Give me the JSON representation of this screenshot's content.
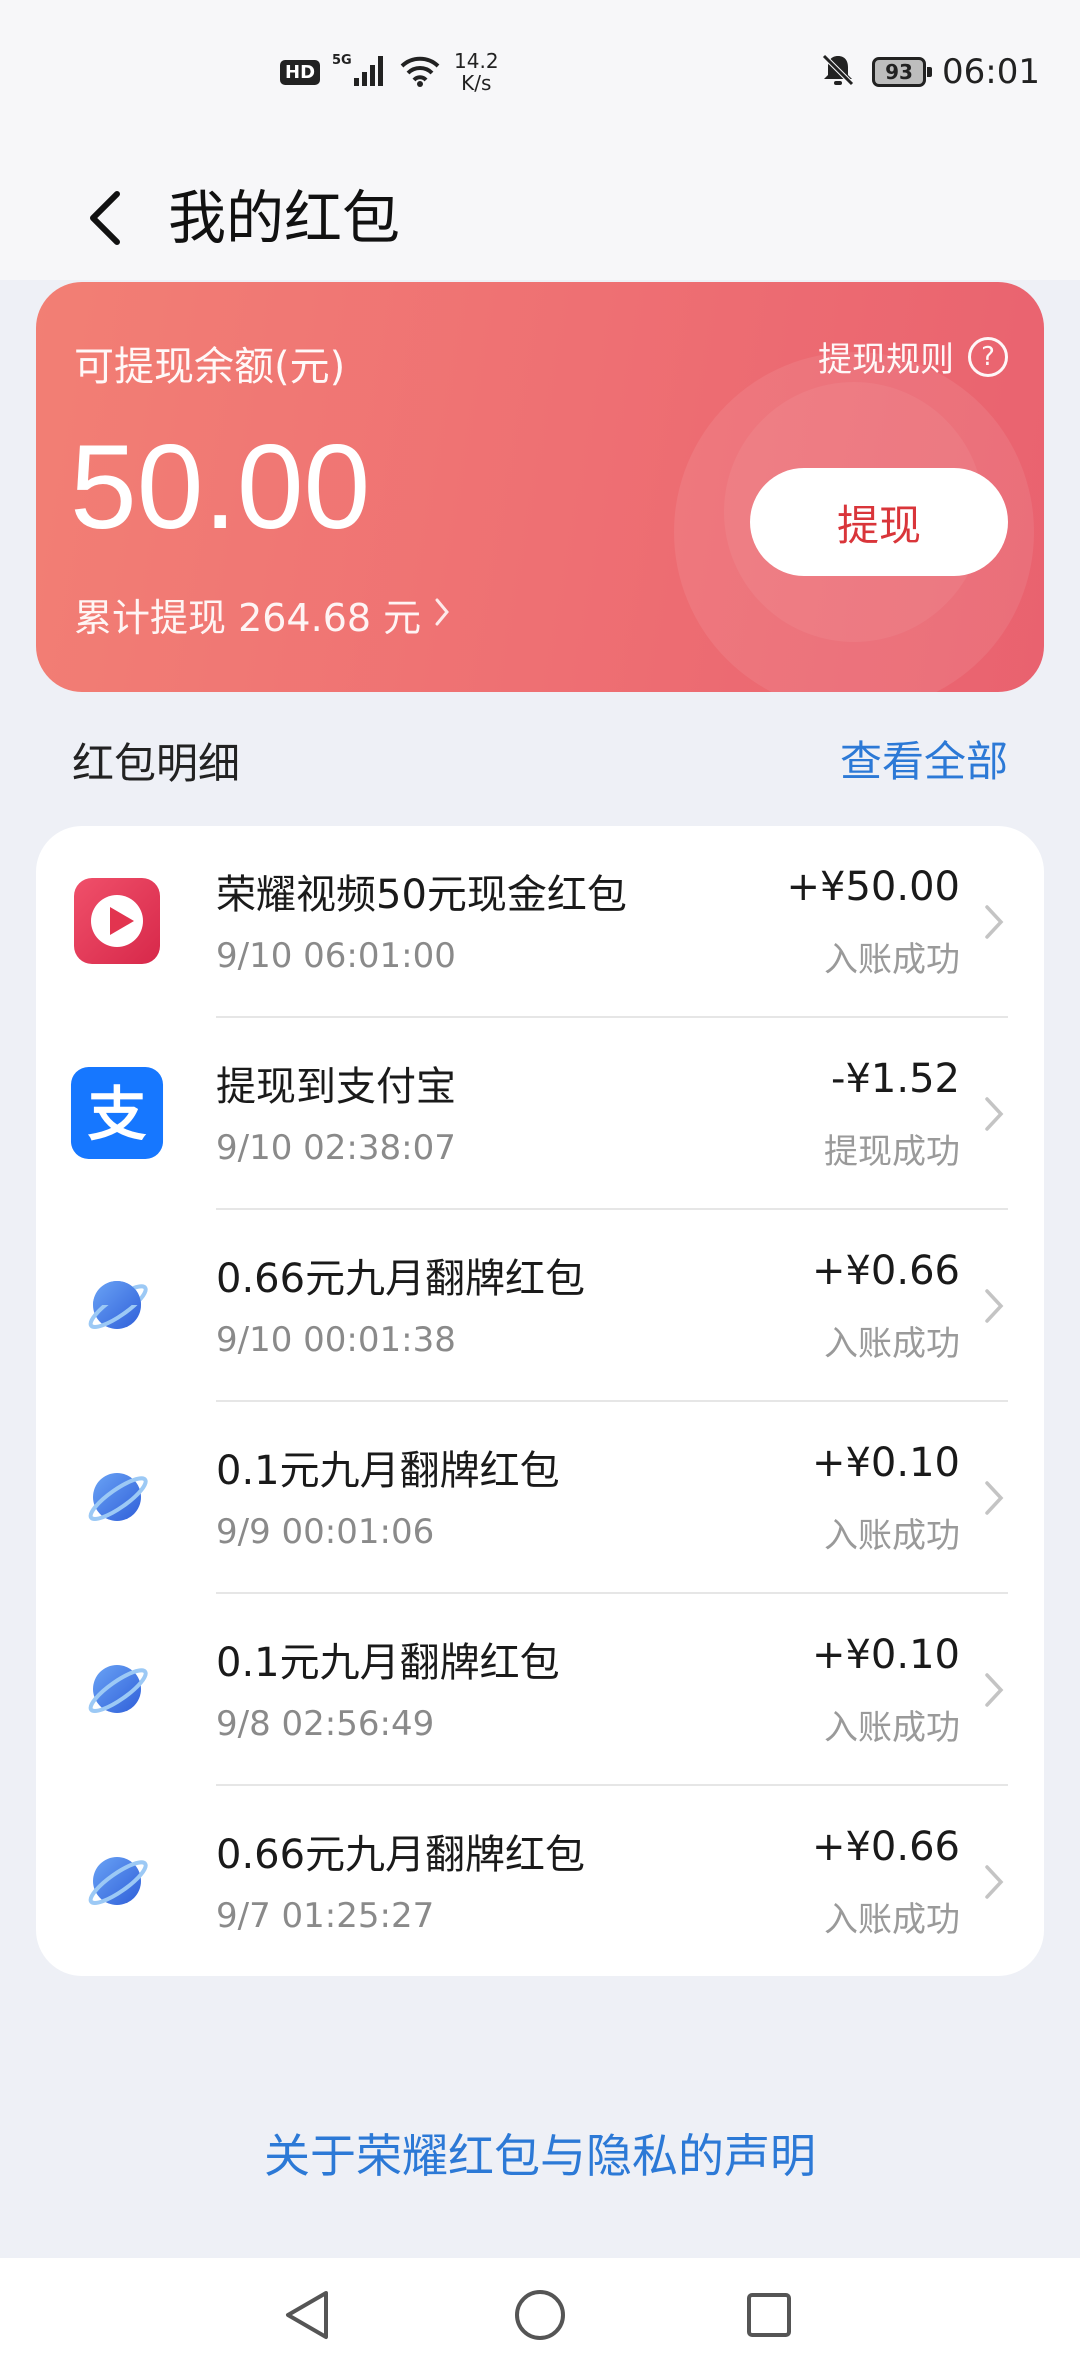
{
  "status_bar": {
    "hd": "HD",
    "network": "5G",
    "speed_value": "14.2",
    "speed_unit": "K/s",
    "battery": "93",
    "time": "06:01"
  },
  "header": {
    "title": "我的红包"
  },
  "balance_card": {
    "label": "可提现余额(元)",
    "rules_label": "提现规则",
    "amount": "50.00",
    "withdraw_label": "提现",
    "total_withdrawn": "累计提现 264.68 元"
  },
  "details": {
    "title": "红包明细",
    "view_all": "查看全部",
    "items": [
      {
        "icon": "honor-video-icon",
        "title": "荣耀视频50元现金红包",
        "time": "9/10 06:01:00",
        "amount": "+¥50.00",
        "status": "入账成功"
      },
      {
        "icon": "alipay-icon",
        "title": "提现到支付宝",
        "time": "9/10 02:38:07",
        "amount": "-¥1.52",
        "status": "提现成功"
      },
      {
        "icon": "planet-icon",
        "title": "0.66元九月翻牌红包",
        "time": "9/10 00:01:38",
        "amount": "+¥0.66",
        "status": "入账成功"
      },
      {
        "icon": "planet-icon",
        "title": "0.1元九月翻牌红包",
        "time": "9/9 00:01:06",
        "amount": "+¥0.10",
        "status": "入账成功"
      },
      {
        "icon": "planet-icon",
        "title": "0.1元九月翻牌红包",
        "time": "9/8 02:56:49",
        "amount": "+¥0.10",
        "status": "入账成功"
      },
      {
        "icon": "planet-icon",
        "title": "0.66元九月翻牌红包",
        "time": "9/7 01:25:27",
        "amount": "+¥0.66",
        "status": "入账成功"
      }
    ]
  },
  "footer": {
    "privacy_link": "关于荣耀红包与隐私的声明"
  },
  "colors": {
    "accent_blue": "#2c79d6",
    "card_red": "#ee6f73",
    "withdraw_text": "#d9353a"
  }
}
